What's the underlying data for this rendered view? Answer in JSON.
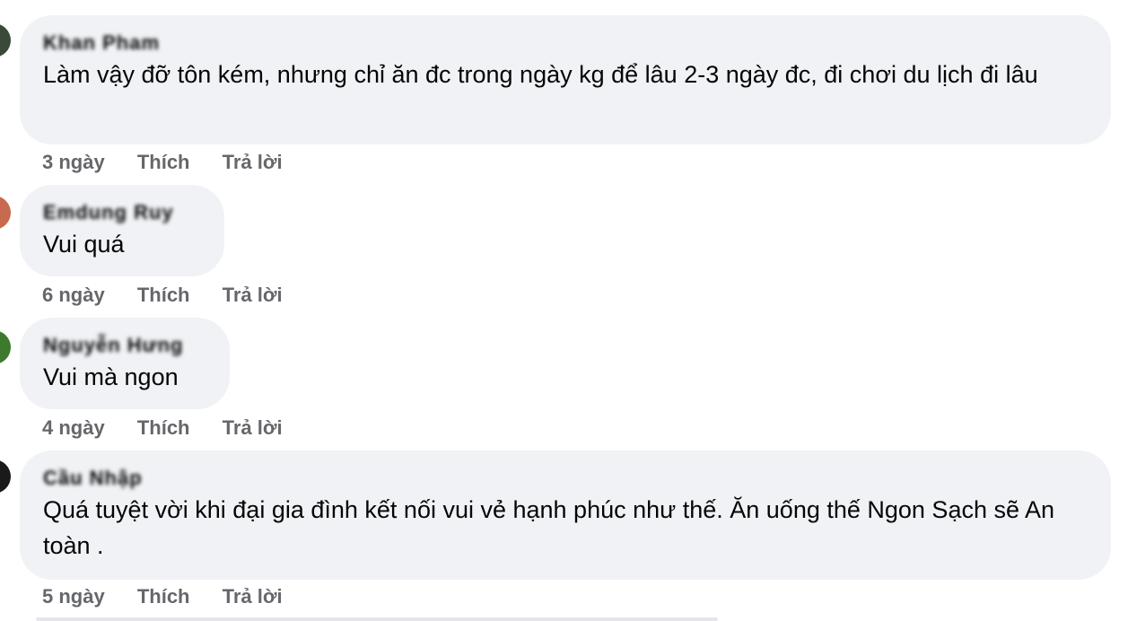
{
  "comments": [
    {
      "author": "Khan Pham",
      "text": "Làm vậy đỡ tôn kém, nhưng chỉ ăn đc trong ngày kg để lâu 2-3 ngày đc, đi chơi du lịch đi lâu",
      "time": "3 ngày",
      "like_label": "Thích",
      "reply_label": "Trả lời",
      "avatar_color": "#3a4a3a"
    },
    {
      "author": "Emdung Ruy",
      "text": "Vui quá",
      "time": "6 ngày",
      "like_label": "Thích",
      "reply_label": "Trả lời",
      "avatar_color": "#c86a50"
    },
    {
      "author": "Nguyễn Hưng",
      "text": "Vui mà ngon",
      "time": "4 ngày",
      "like_label": "Thích",
      "reply_label": "Trả lời",
      "avatar_color": "#3d7a2e"
    },
    {
      "author": "Cầu Nhập",
      "text": "Quá tuyệt vời khi đại gia đình kết nối vui vẻ hạnh phúc như thế. Ăn uống thế Ngon Sạch sẽ An toàn .",
      "time": "5 ngày",
      "like_label": "Thích",
      "reply_label": "Trả lời",
      "avatar_color": "#1a1a1a"
    }
  ]
}
